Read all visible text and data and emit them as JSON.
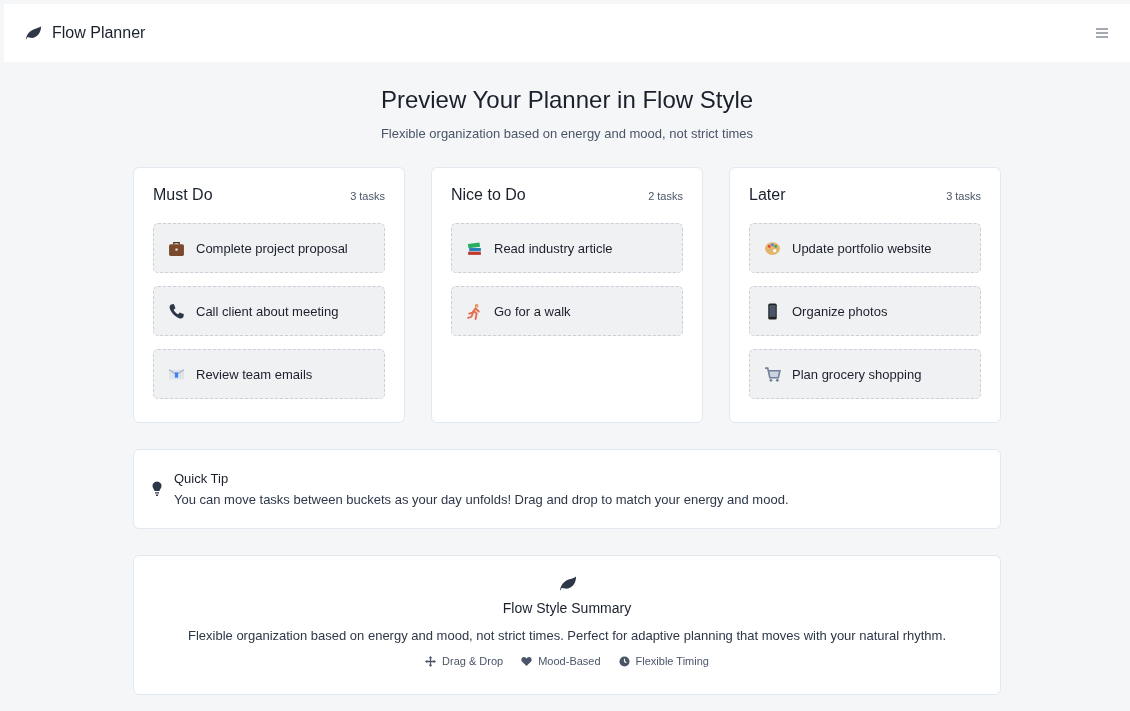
{
  "app": {
    "title": "Flow Planner"
  },
  "heading": "Preview Your Planner in Flow Style",
  "subheading": "Flexible organization based on energy and mood, not strict times",
  "buckets": [
    {
      "title": "Must Do",
      "count": "3 tasks",
      "tasks": [
        {
          "kind": "briefcase",
          "label": "Complete project proposal"
        },
        {
          "kind": "phone",
          "label": "Call client about meeting"
        },
        {
          "kind": "envelope",
          "label": "Review team emails"
        }
      ]
    },
    {
      "title": "Nice to Do",
      "count": "2 tasks",
      "tasks": [
        {
          "kind": "books",
          "label": "Read industry article"
        },
        {
          "kind": "runner",
          "label": "Go for a walk"
        }
      ]
    },
    {
      "title": "Later",
      "count": "3 tasks",
      "tasks": [
        {
          "kind": "palette",
          "label": "Update portfolio website"
        },
        {
          "kind": "mobile",
          "label": "Organize photos"
        },
        {
          "kind": "cart",
          "label": "Plan grocery shopping"
        }
      ]
    }
  ],
  "tip": {
    "title": "Quick Tip",
    "text": "You can move tasks between buckets as your day unfolds! Drag and drop to match your energy and mood."
  },
  "summary": {
    "title": "Flow Style Summary",
    "text": "Flexible organization based on energy and mood, not strict times. Perfect for adaptive planning that moves with your natural rhythm.",
    "features": [
      {
        "kind": "move",
        "label": "Drag & Drop"
      },
      {
        "kind": "heart",
        "label": "Mood-Based"
      },
      {
        "kind": "clock",
        "label": "Flexible Timing"
      }
    ]
  }
}
